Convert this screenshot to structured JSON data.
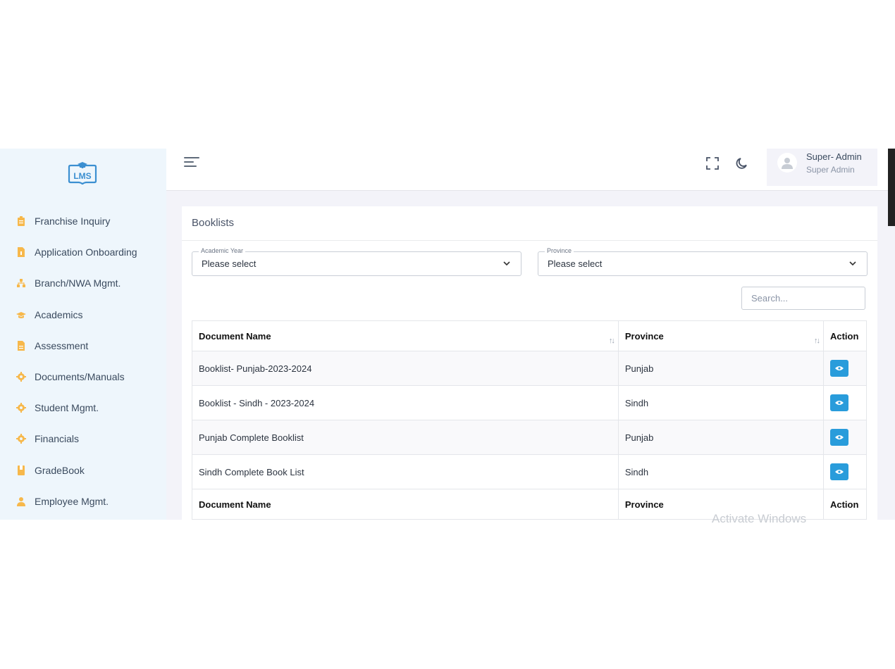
{
  "sidebar": {
    "logo_text": "LMS",
    "items": [
      {
        "label": "Franchise Inquiry",
        "icon": "clipboard-icon"
      },
      {
        "label": "Application Onboarding",
        "icon": "file-icon"
      },
      {
        "label": "Branch/NWA Mgmt.",
        "icon": "sitemap-icon"
      },
      {
        "label": "Academics",
        "icon": "graduation-cap-icon"
      },
      {
        "label": "Assessment",
        "icon": "document-icon"
      },
      {
        "label": "Documents/Manuals",
        "icon": "gear-icon"
      },
      {
        "label": "Student Mgmt.",
        "icon": "gear-icon"
      },
      {
        "label": "Financials",
        "icon": "gear-icon"
      },
      {
        "label": "GradeBook",
        "icon": "book-icon"
      },
      {
        "label": "Employee Mgmt.",
        "icon": "user-icon"
      }
    ],
    "icon_color": "#f7b84b"
  },
  "header": {
    "user_name": "Super- Admin",
    "user_role": "Super Admin"
  },
  "page": {
    "title": "Booklists",
    "filters": {
      "academic_year": {
        "label": "Academic Year",
        "value": "Please select"
      },
      "province": {
        "label": "Province",
        "value": "Please select"
      }
    },
    "search_placeholder": "Search...",
    "table": {
      "columns": [
        "Document Name",
        "Province",
        "Action"
      ],
      "rows": [
        {
          "name": "Booklist- Punjab-2023-2024",
          "province": "Punjab"
        },
        {
          "name": "Booklist - Sindh - 2023-2024",
          "province": "Sindh"
        },
        {
          "name": "Punjab Complete Booklist",
          "province": "Punjab"
        },
        {
          "name": "Sindh Complete Book List",
          "province": "Sindh"
        }
      ]
    }
  },
  "watermark": "Activate Windows",
  "colors": {
    "accent": "#299cdb",
    "sidebar_bg": "#eef6fc",
    "logo": "#3b8fd1"
  }
}
